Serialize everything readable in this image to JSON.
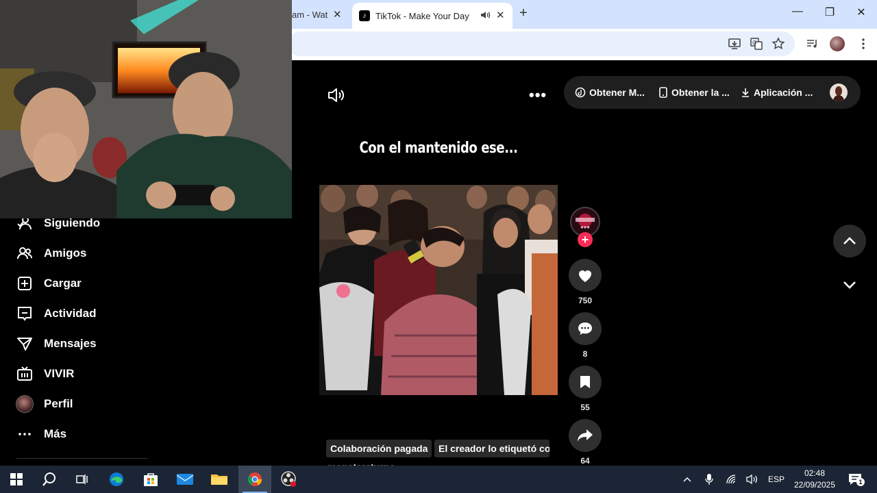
{
  "browser": {
    "tabs": [
      {
        "label": "am - Wat",
        "active": false
      },
      {
        "label": "TikTok - Make Your Day",
        "active": true
      }
    ],
    "favicon_glyph": "♪",
    "new_tab": "+",
    "window_controls": {
      "minimize": "—",
      "restore": "❐",
      "close": "✕"
    }
  },
  "sidebar": {
    "items": [
      {
        "label": "Siguiendo",
        "icon": "following-icon"
      },
      {
        "label": "Amigos",
        "icon": "friends-icon"
      },
      {
        "label": "Cargar",
        "icon": "upload-icon"
      },
      {
        "label": "Actividad",
        "icon": "activity-icon"
      },
      {
        "label": "Mensajes",
        "icon": "messages-icon"
      },
      {
        "label": "VIVIR",
        "icon": "live-icon"
      },
      {
        "label": "Perfil",
        "icon": "profile-avatar"
      },
      {
        "label": "Más",
        "icon": "more-icon"
      }
    ]
  },
  "top_actions": {
    "more": "•••",
    "get_coins": "Obtener M...",
    "get_app": "Obtener la ...",
    "download_app": "Aplicación ..."
  },
  "video": {
    "caption": "Con el mantenido ese...",
    "likes": "750",
    "comments": "8",
    "saves": "55",
    "shares": "64",
    "follow_plus": "+"
  },
  "tags": [
    "Colaboración pagada",
    "El creador lo etiquetó co"
  ],
  "username_partial": "monstercturno",
  "taskbar": {
    "language": "ESP",
    "time": "02:48",
    "date": "22/09/2025",
    "notification_count": "1"
  },
  "colors": {
    "tiktok_red": "#fe2c55",
    "chrome_tab_strip": "#d3e3fd",
    "taskbar": "#1c2535"
  }
}
